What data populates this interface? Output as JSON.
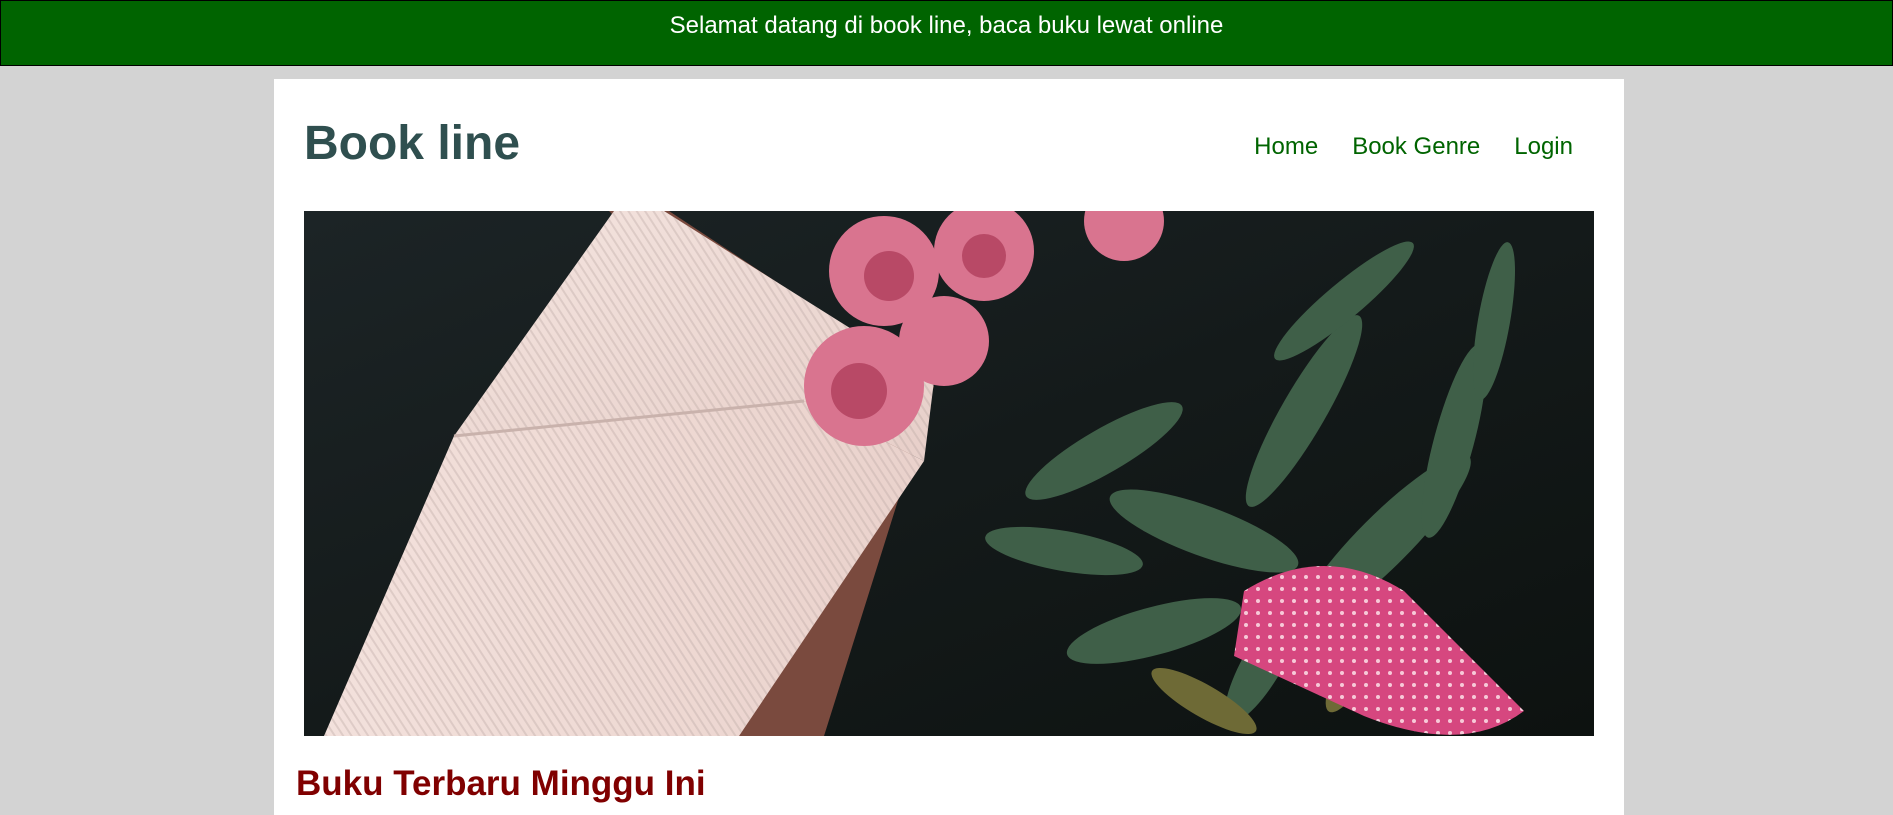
{
  "banner": {
    "text": "Selamat datang di book line, baca buku lewat online"
  },
  "header": {
    "brand": "Book line",
    "nav": [
      {
        "label": "Home"
      },
      {
        "label": "Book Genre"
      },
      {
        "label": "Login"
      }
    ]
  },
  "hero": {
    "alt": "Open book next to a bouquet of pink peonies"
  },
  "main": {
    "section_title": "Buku Terbaru Minggu Ini"
  },
  "colors": {
    "banner_bg": "#006400",
    "brand": "#2f4f4f",
    "nav_link": "#006400",
    "section_title": "#800000",
    "page_bg": "#d3d3d3"
  }
}
